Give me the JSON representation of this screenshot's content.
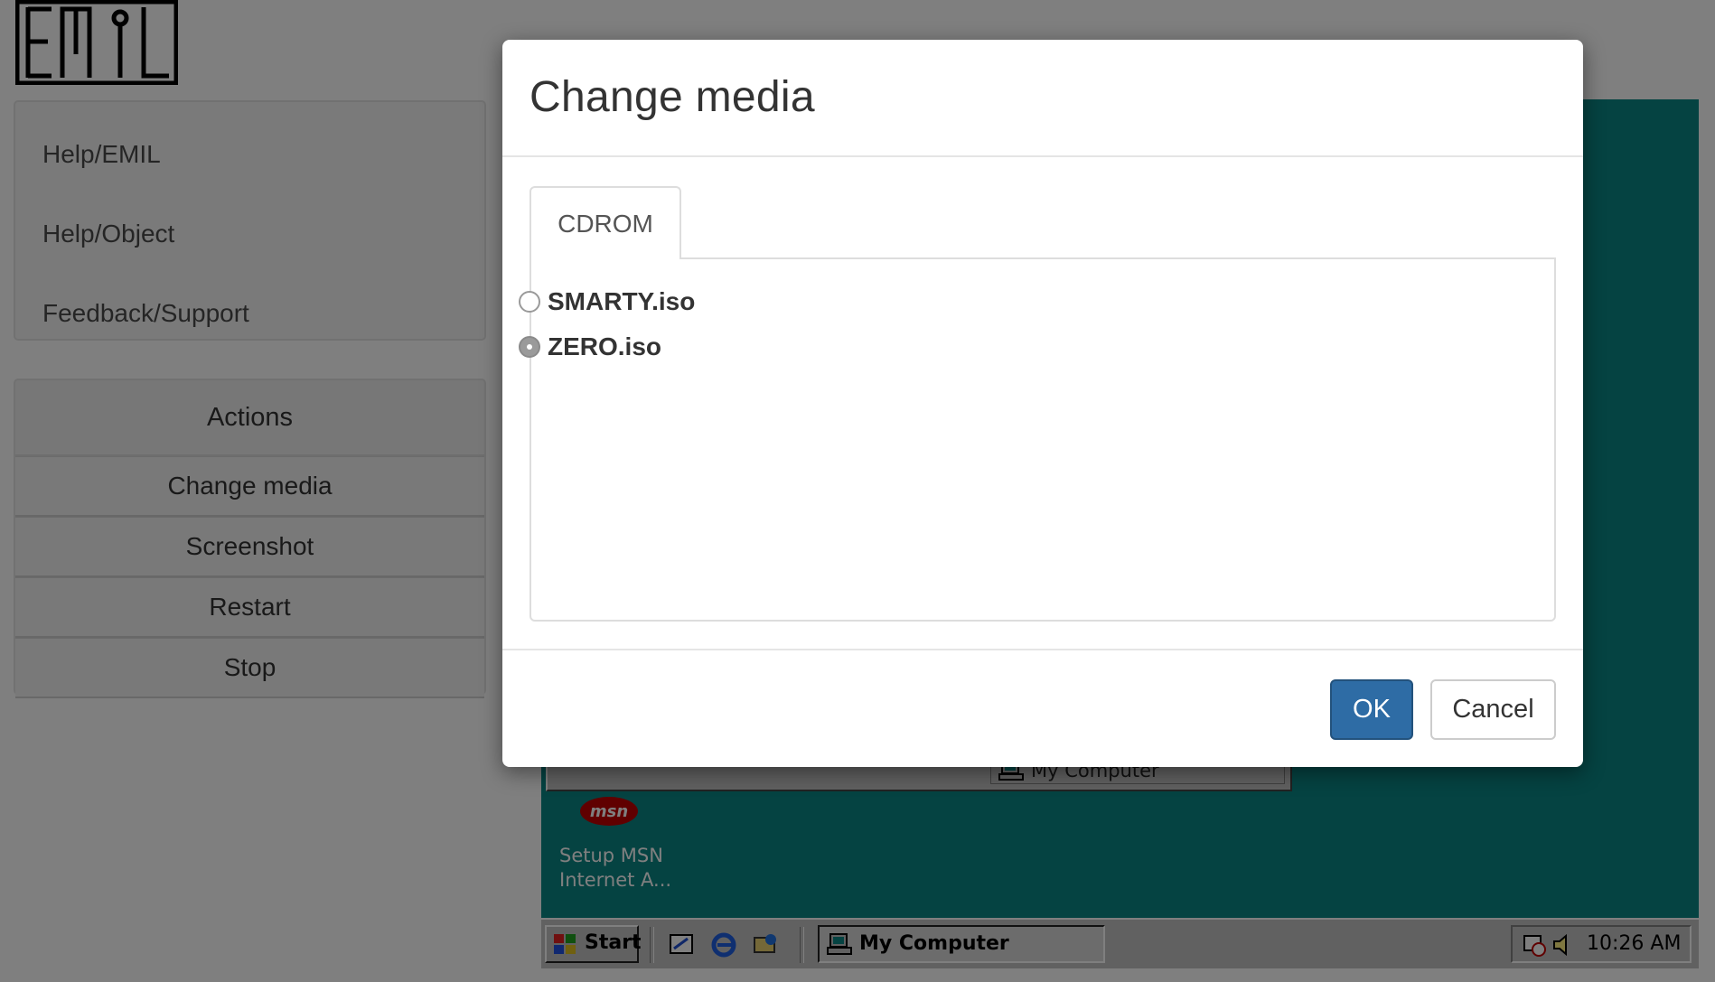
{
  "logo": {
    "alt": "EMIL"
  },
  "sidebar": {
    "help_links": [
      {
        "label": "Help/EMIL"
      },
      {
        "label": "Help/Object"
      },
      {
        "label": "Feedback/Support"
      }
    ],
    "actions": {
      "title": "Actions",
      "buttons": [
        {
          "label": "Change media"
        },
        {
          "label": "Screenshot"
        },
        {
          "label": "Restart"
        },
        {
          "label": "Stop"
        }
      ]
    }
  },
  "emulator": {
    "window_status": "My Computer",
    "desktop_icon_label": "Setup MSN Internet A...",
    "msn_logo_text": "msn",
    "taskbar": {
      "start_label": "Start",
      "task_label": "My Computer",
      "clock": "10:26 AM"
    },
    "colors": {
      "desktop": "#0b8684",
      "taskbar": "#c3c3c3"
    }
  },
  "modal": {
    "title": "Change media",
    "tab_label": "CDROM",
    "options": [
      {
        "label": "SMARTY.iso",
        "selected": false
      },
      {
        "label": "ZERO.iso",
        "selected": true
      }
    ],
    "ok_label": "OK",
    "cancel_label": "Cancel",
    "colors": {
      "primary": "#2e6ca5"
    }
  }
}
